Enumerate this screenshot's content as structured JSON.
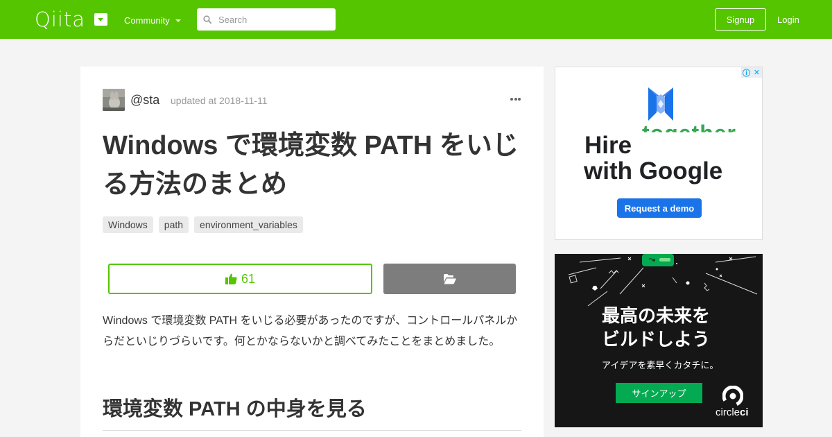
{
  "header": {
    "logo": "Qiita",
    "community_label": "Community",
    "search_placeholder": "Search",
    "signup_label": "Signup",
    "login_label": "Login",
    "brand_color": "#55c500"
  },
  "article": {
    "author": "@sta",
    "updated": "updated at 2018-11-11",
    "title": "Windows で環境変数 PATH をいじる方法のまとめ",
    "tags": [
      "Windows",
      "path",
      "environment_variables"
    ],
    "like_count": "61",
    "body": "Windows で環境変数 PATH をいじる必要があったのですが、コントロールパネルからだといじりづらいです。何とかならないかと調べてみたことをまとめました。",
    "section_heading": "環境変数 PATH の中身を見る"
  },
  "ads": {
    "google": {
      "ghost_text": "together",
      "line1": "Hire",
      "line2": "with Google",
      "button": "Request a demo"
    },
    "circleci": {
      "line1": "最高の未来を",
      "line2": "ビルドしよう",
      "sub": "アイデアを素早くカタチに。",
      "button": "サインアップ",
      "brand": "circle",
      "brand_bold": "ci"
    }
  }
}
